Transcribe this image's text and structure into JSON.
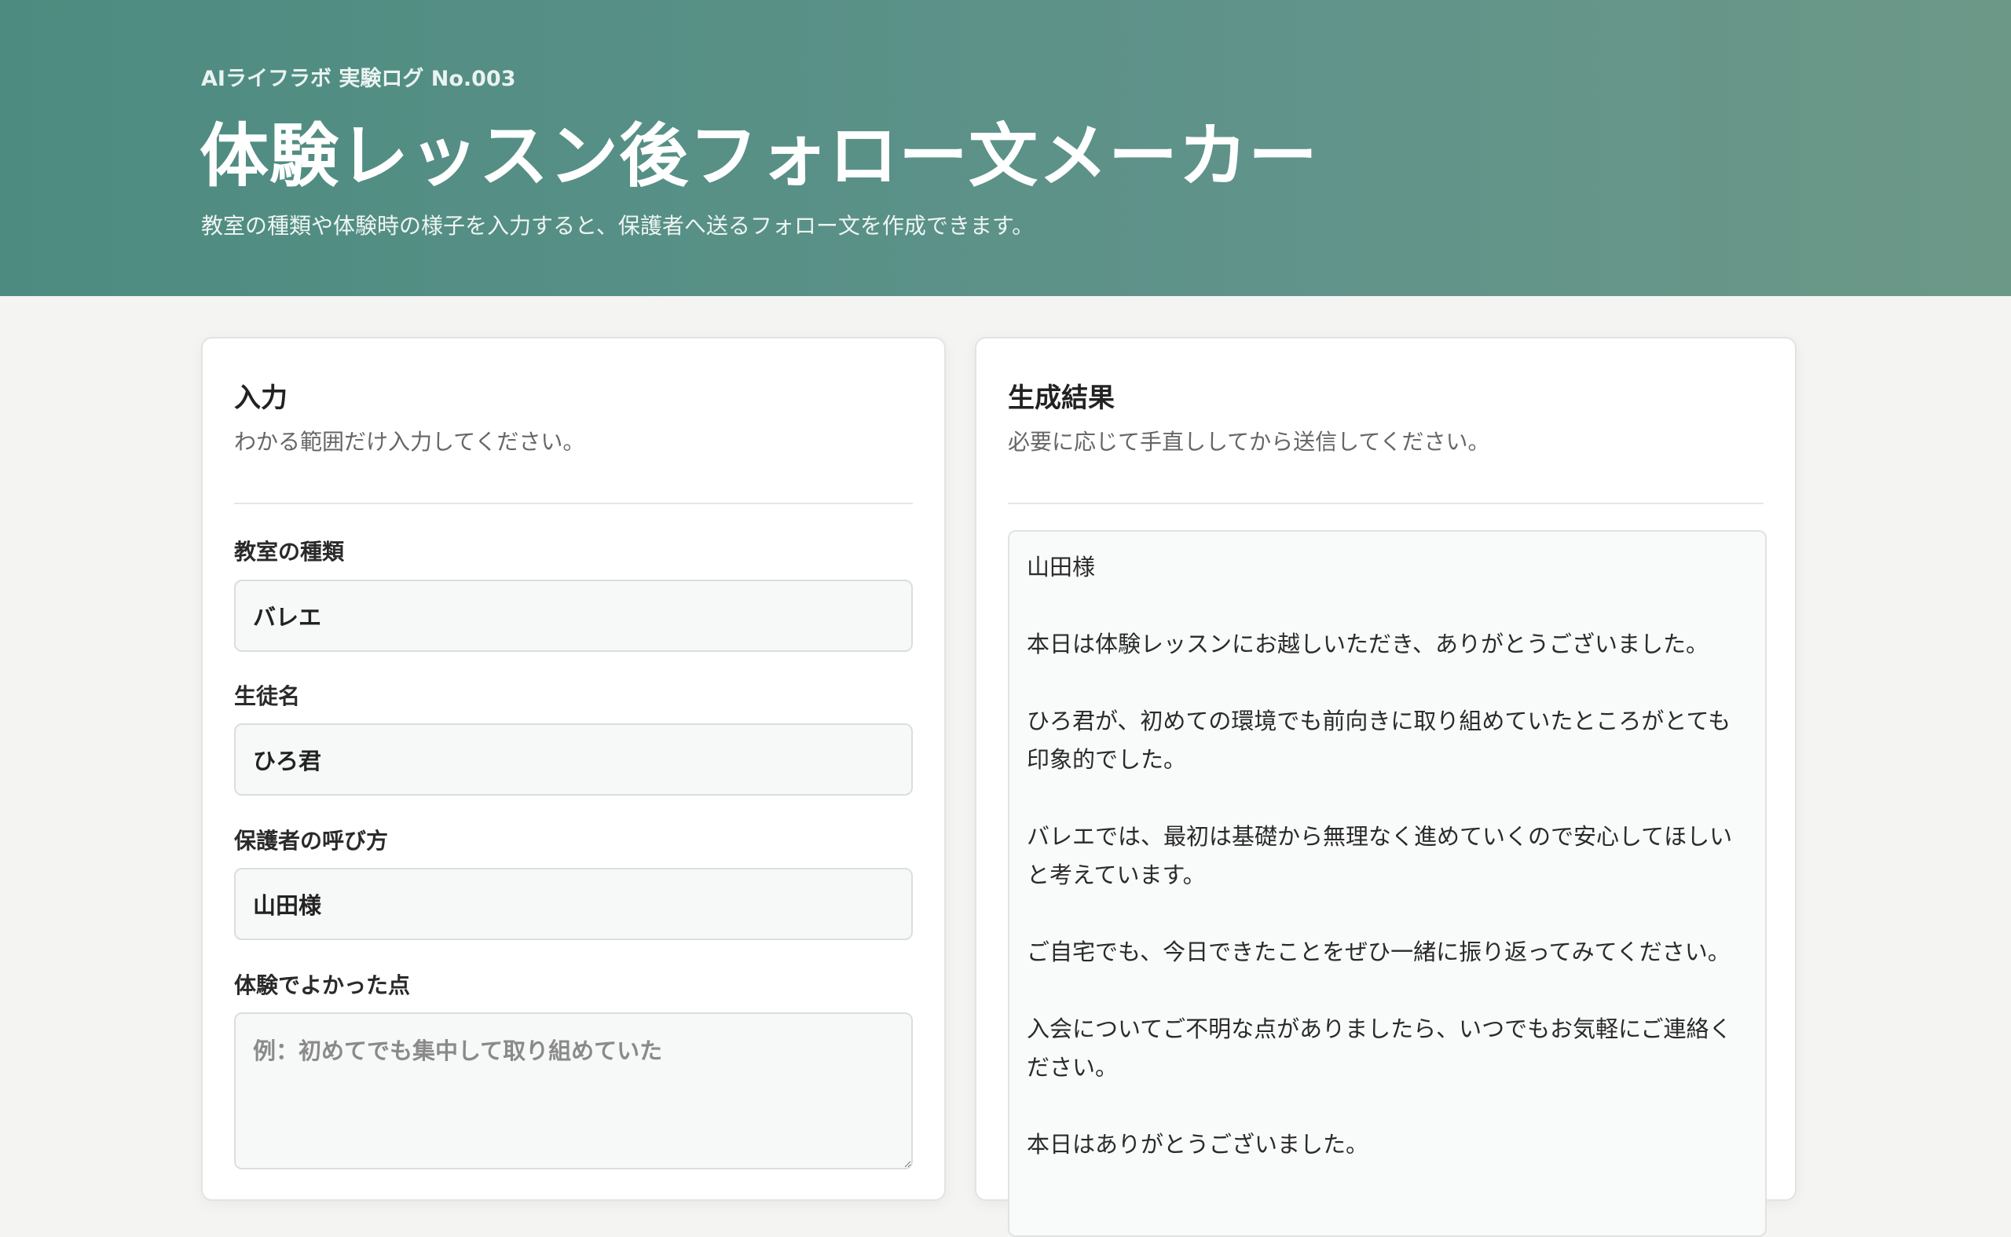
{
  "header": {
    "kicker": "AIライフラボ 実験ログ No.003",
    "title": "体験レッスン後フォロー文メーカー",
    "subtitle": "教室の種類や体験時の様子を入力すると、保護者へ送るフォロー文を作成できます。"
  },
  "input_panel": {
    "title": "入力",
    "description": "わかる範囲だけ入力してください。",
    "fields": {
      "classroom_type": {
        "label": "教室の種類",
        "value": "バレエ"
      },
      "student_name": {
        "label": "生徒名",
        "value": "ひろ君"
      },
      "guardian_name": {
        "label": "保護者の呼び方",
        "value": "山田様"
      },
      "good_points": {
        "label": "体験でよかった点",
        "placeholder": "例：初めてでも集中して取り組めていた"
      }
    }
  },
  "output_panel": {
    "title": "生成結果",
    "description": "必要に応じて手直ししてから送信してください。",
    "lines": [
      "山田様",
      "",
      "本日は体験レッスンにお越しいただき、ありがとうございました。",
      "",
      "ひろ君が、初めての環境でも前向きに取り組めていたところがとても",
      "印象的でした。",
      "",
      "バレエでは、最初は基礎から無理なく進めていくので安心してほしい",
      "と考えています。",
      "",
      "ご自宅でも、今日できたことをぜひ一緒に振り返ってみてください。",
      "",
      "入会についてご不明な点がありましたら、いつでもお気軽にご連絡く",
      "ださい。",
      "",
      "本日はありがとうございました。"
    ]
  }
}
